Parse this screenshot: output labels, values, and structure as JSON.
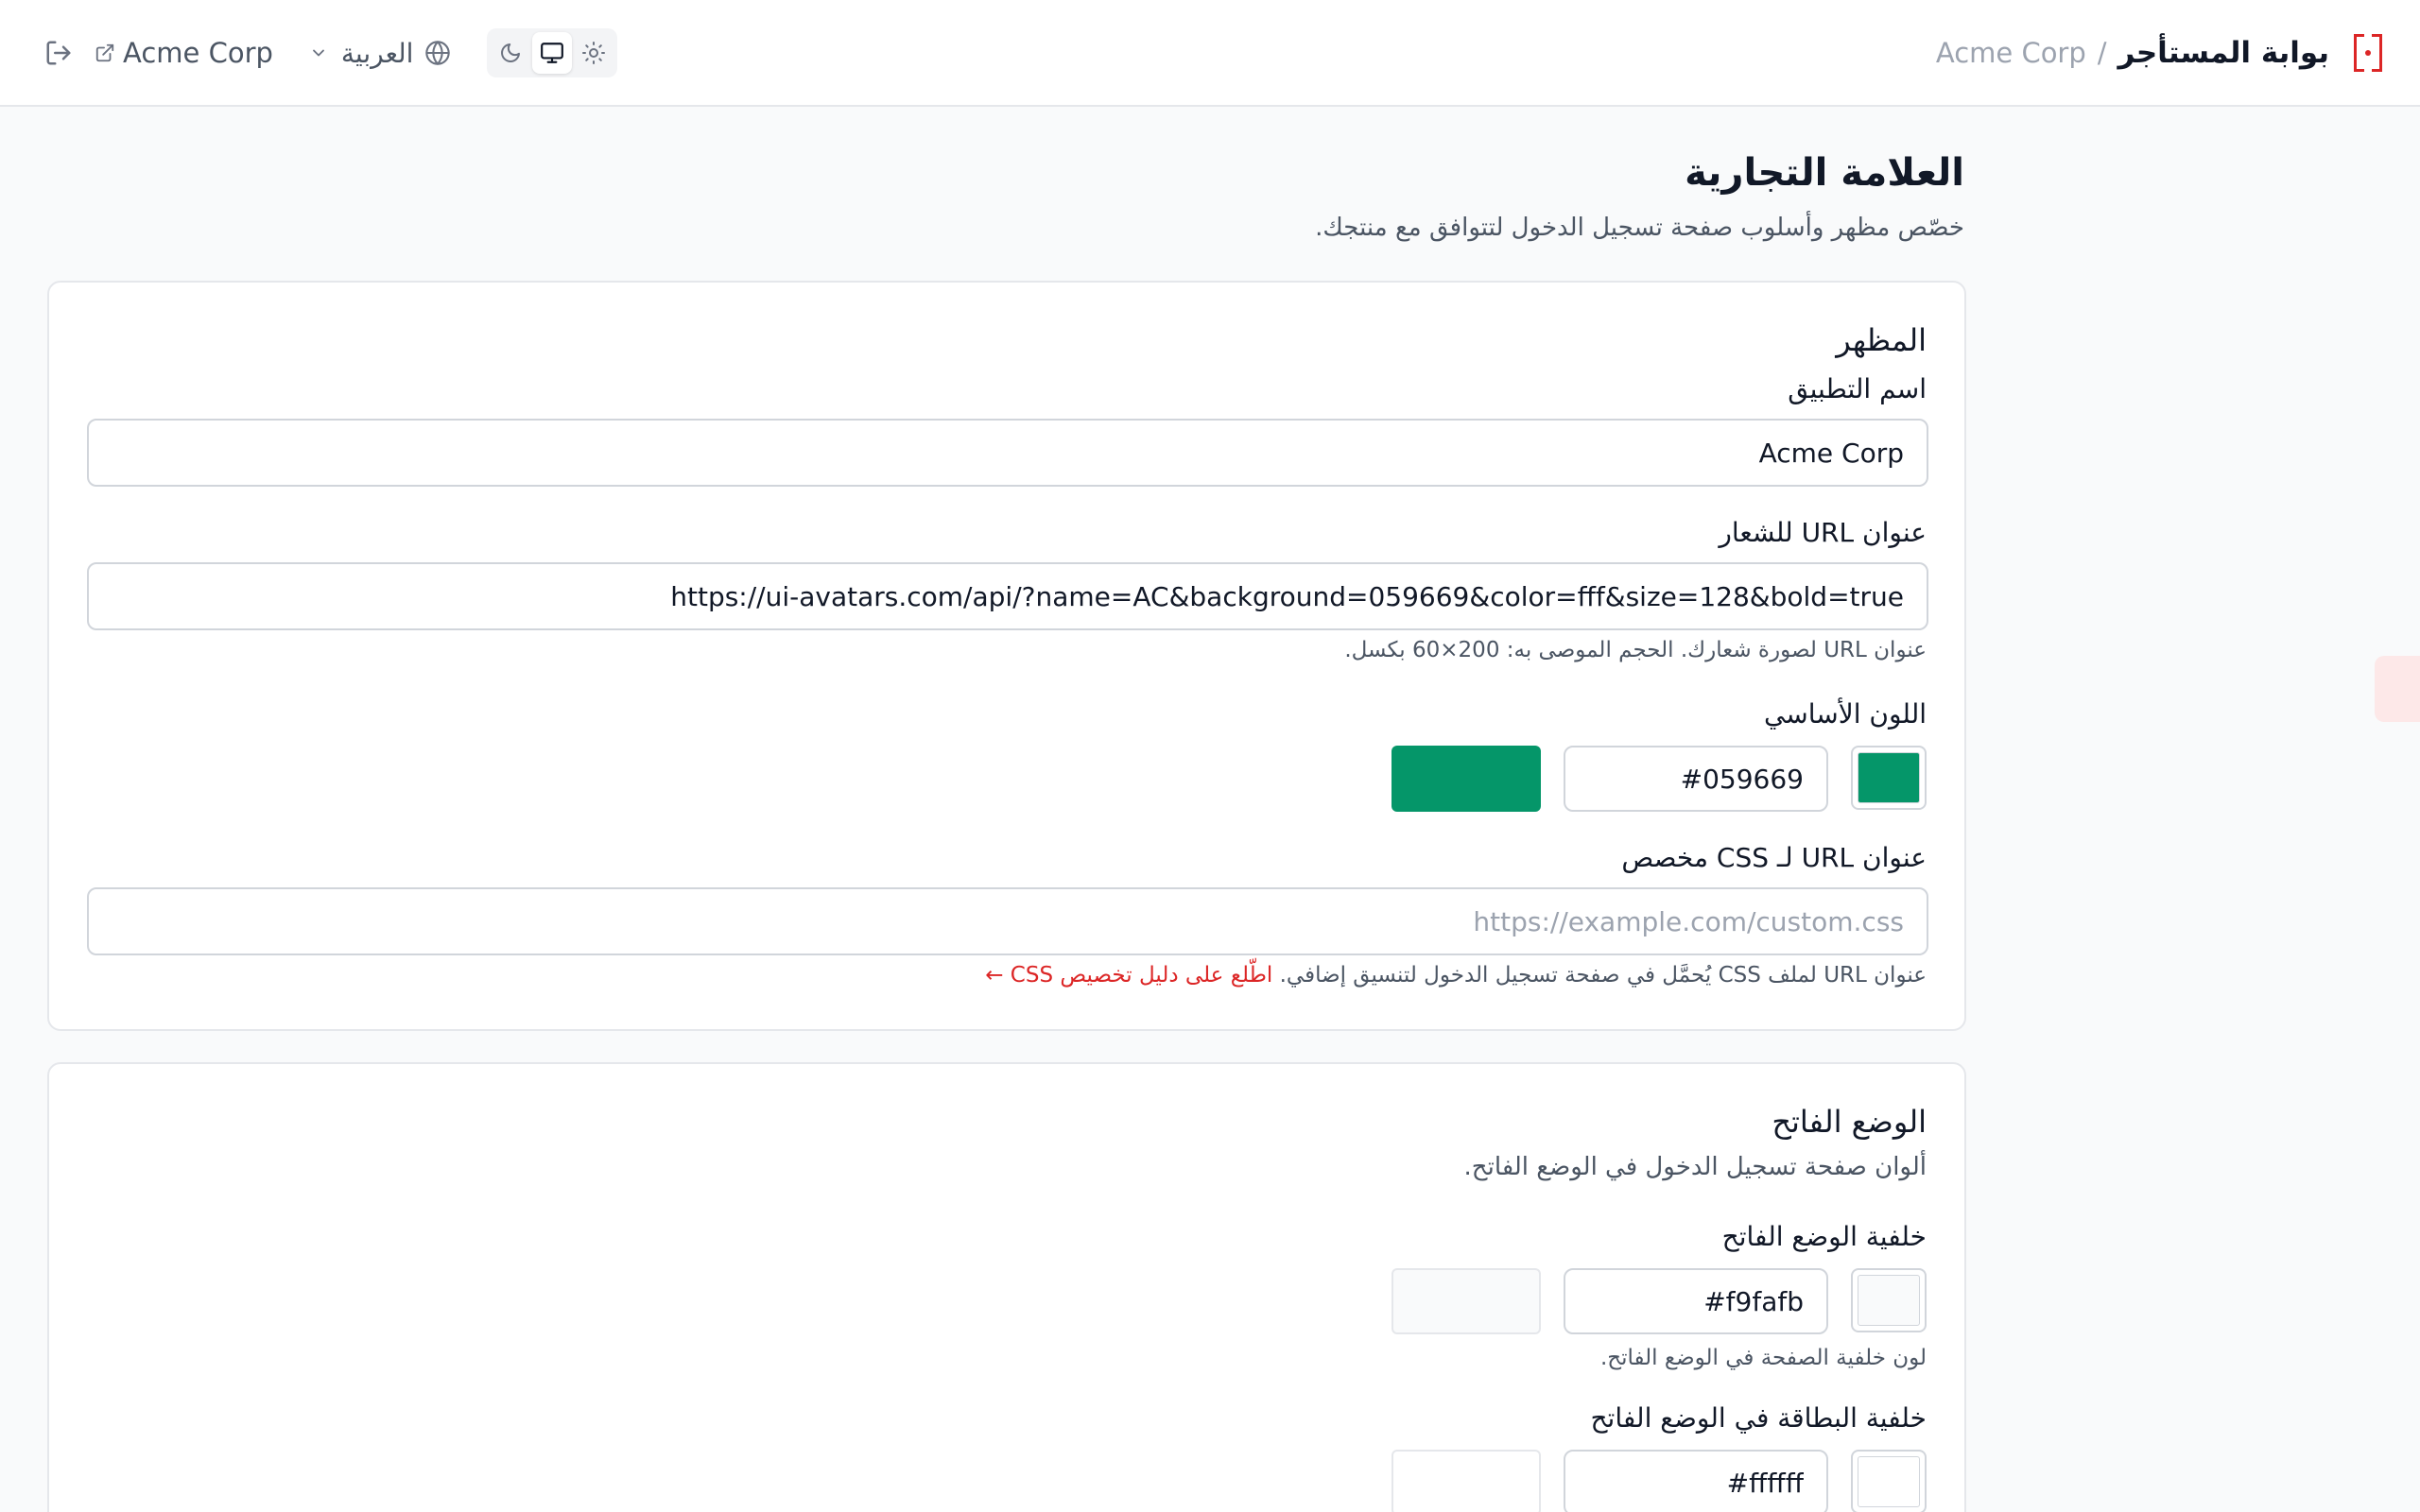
{
  "header": {
    "portal_title": "بوابة المستأجر",
    "separator": "/",
    "tenant_breadcrumb": "Acme Corp",
    "tenant_link": "Acme Corp",
    "language": "العربية",
    "theme_options": [
      "dark",
      "system",
      "light"
    ],
    "theme_selected": "system"
  },
  "page": {
    "title": "العلامة التجارية",
    "subtitle": "خصّص مظهر وأسلوب صفحة تسجيل الدخول لتتوافق مع منتجك."
  },
  "appearance": {
    "title": "المظهر",
    "app_name": {
      "label": "اسم التطبيق",
      "value": "Acme Corp"
    },
    "logo_url": {
      "label": "عنوان URL للشعار",
      "value": "https://ui-avatars.com/api/?name=AC&background=059669&color=fff&size=128&bold=true",
      "hint": "عنوان URL لصورة شعارك. الحجم الموصى به: 200×60 بكسل."
    },
    "primary_color": {
      "label": "اللون الأساسي",
      "value": "#059669",
      "color": "#059669"
    },
    "custom_css": {
      "label": "عنوان URL لـ CSS مخصص",
      "value": "",
      "placeholder": "https://example.com/custom.css",
      "hint": "عنوان URL لملف CSS يُحمَّل في صفحة تسجيل الدخول لتنسيق إضافي.",
      "hint_link": "اطّلع على دليل تخصيص CSS ←"
    }
  },
  "light_mode": {
    "title": "الوضع الفاتح",
    "description": "ألوان صفحة تسجيل الدخول في الوضع الفاتح.",
    "background": {
      "label": "خلفية الوضع الفاتح",
      "value": "#f9fafb",
      "color": "#f9fafb",
      "hint": "لون خلفية الصفحة في الوضع الفاتح."
    },
    "card_background": {
      "label": "خلفية البطاقة في الوضع الفاتح",
      "value": "#ffffff",
      "color": "#ffffff"
    }
  },
  "colors": {
    "accent": "#dc2626",
    "border": "#e5e7eb",
    "page_bg": "#f9fafb"
  }
}
